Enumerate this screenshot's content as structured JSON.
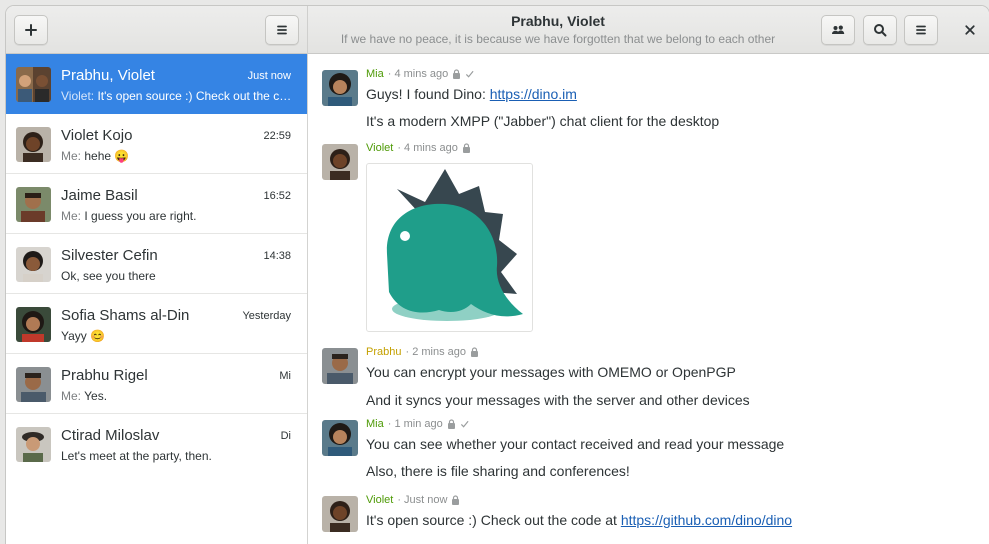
{
  "header": {
    "title": "Prabhu, Violet",
    "subtitle": "If we have no peace, it is because we have forgotten that we belong to each other",
    "new_label": "+",
    "icons": [
      "plus-icon",
      "hamburger-menu-icon",
      "contacts-icon",
      "search-icon",
      "hamburger-menu-icon",
      "close-icon"
    ]
  },
  "conversations": [
    {
      "name": "Prabhu, Violet",
      "time": "Just now",
      "sender": "Violet:",
      "preview": " It's open source :) Check out the co...",
      "selected": true
    },
    {
      "name": "Violet Kojo",
      "time": "22:59",
      "sender": "Me:",
      "preview": " hehe 😛"
    },
    {
      "name": "Jaime Basil",
      "time": "16:52",
      "sender": "Me:",
      "preview": " I guess you are right."
    },
    {
      "name": "Silvester Cefin",
      "time": "14:38",
      "sender": "",
      "preview": "Ok, see you there"
    },
    {
      "name": "Sofia Shams al-Din",
      "time": "Yesterday",
      "sender": "",
      "preview": "Yayy 😊"
    },
    {
      "name": "Prabhu Rigel",
      "time": "Mi",
      "sender": "Me:",
      "preview": " Yes."
    },
    {
      "name": "Ctirad Miloslav",
      "time": "Di",
      "sender": "",
      "preview": "Let's meet at the party, then."
    }
  ],
  "messages": [
    {
      "author": "Mia",
      "author_color": "#4e9a06",
      "time": "· 4 mins ago",
      "lines": [
        {
          "text": "Guys! I found Dino: ",
          "link": "https://dino.im"
        },
        {
          "text": "It's a modern XMPP (\"Jabber\") chat client for the desktop"
        }
      ]
    },
    {
      "author": "Violet",
      "author_color": "#4e9a06",
      "time": "· 4 mins ago",
      "image": "dino-logo"
    },
    {
      "author": "Prabhu",
      "author_color": "#c4a000",
      "time": "· 2 mins ago",
      "lines": [
        {
          "text": "You can encrypt your messages with OMEMO or OpenPGP"
        },
        {
          "text": "And it syncs your messages with the server and other devices"
        }
      ]
    },
    {
      "author": "Mia",
      "author_color": "#4e9a06",
      "time": "· 1 min ago",
      "lines": [
        {
          "text": "You can see whether your contact received and read your message"
        },
        {
          "text": "Also, there is file sharing and conferences!"
        }
      ]
    },
    {
      "author": "Violet",
      "author_color": "#4e9a06",
      "time": "· Just now",
      "lines": [
        {
          "text": "It's open source :) Check out the code at ",
          "link": "https://github.com/dino/dino"
        }
      ]
    }
  ],
  "colors": {
    "accent": "#3584e4",
    "link": "#1a5fb4",
    "dino_teal": "#1f9e8a",
    "dino_spikes": "#37474f"
  }
}
